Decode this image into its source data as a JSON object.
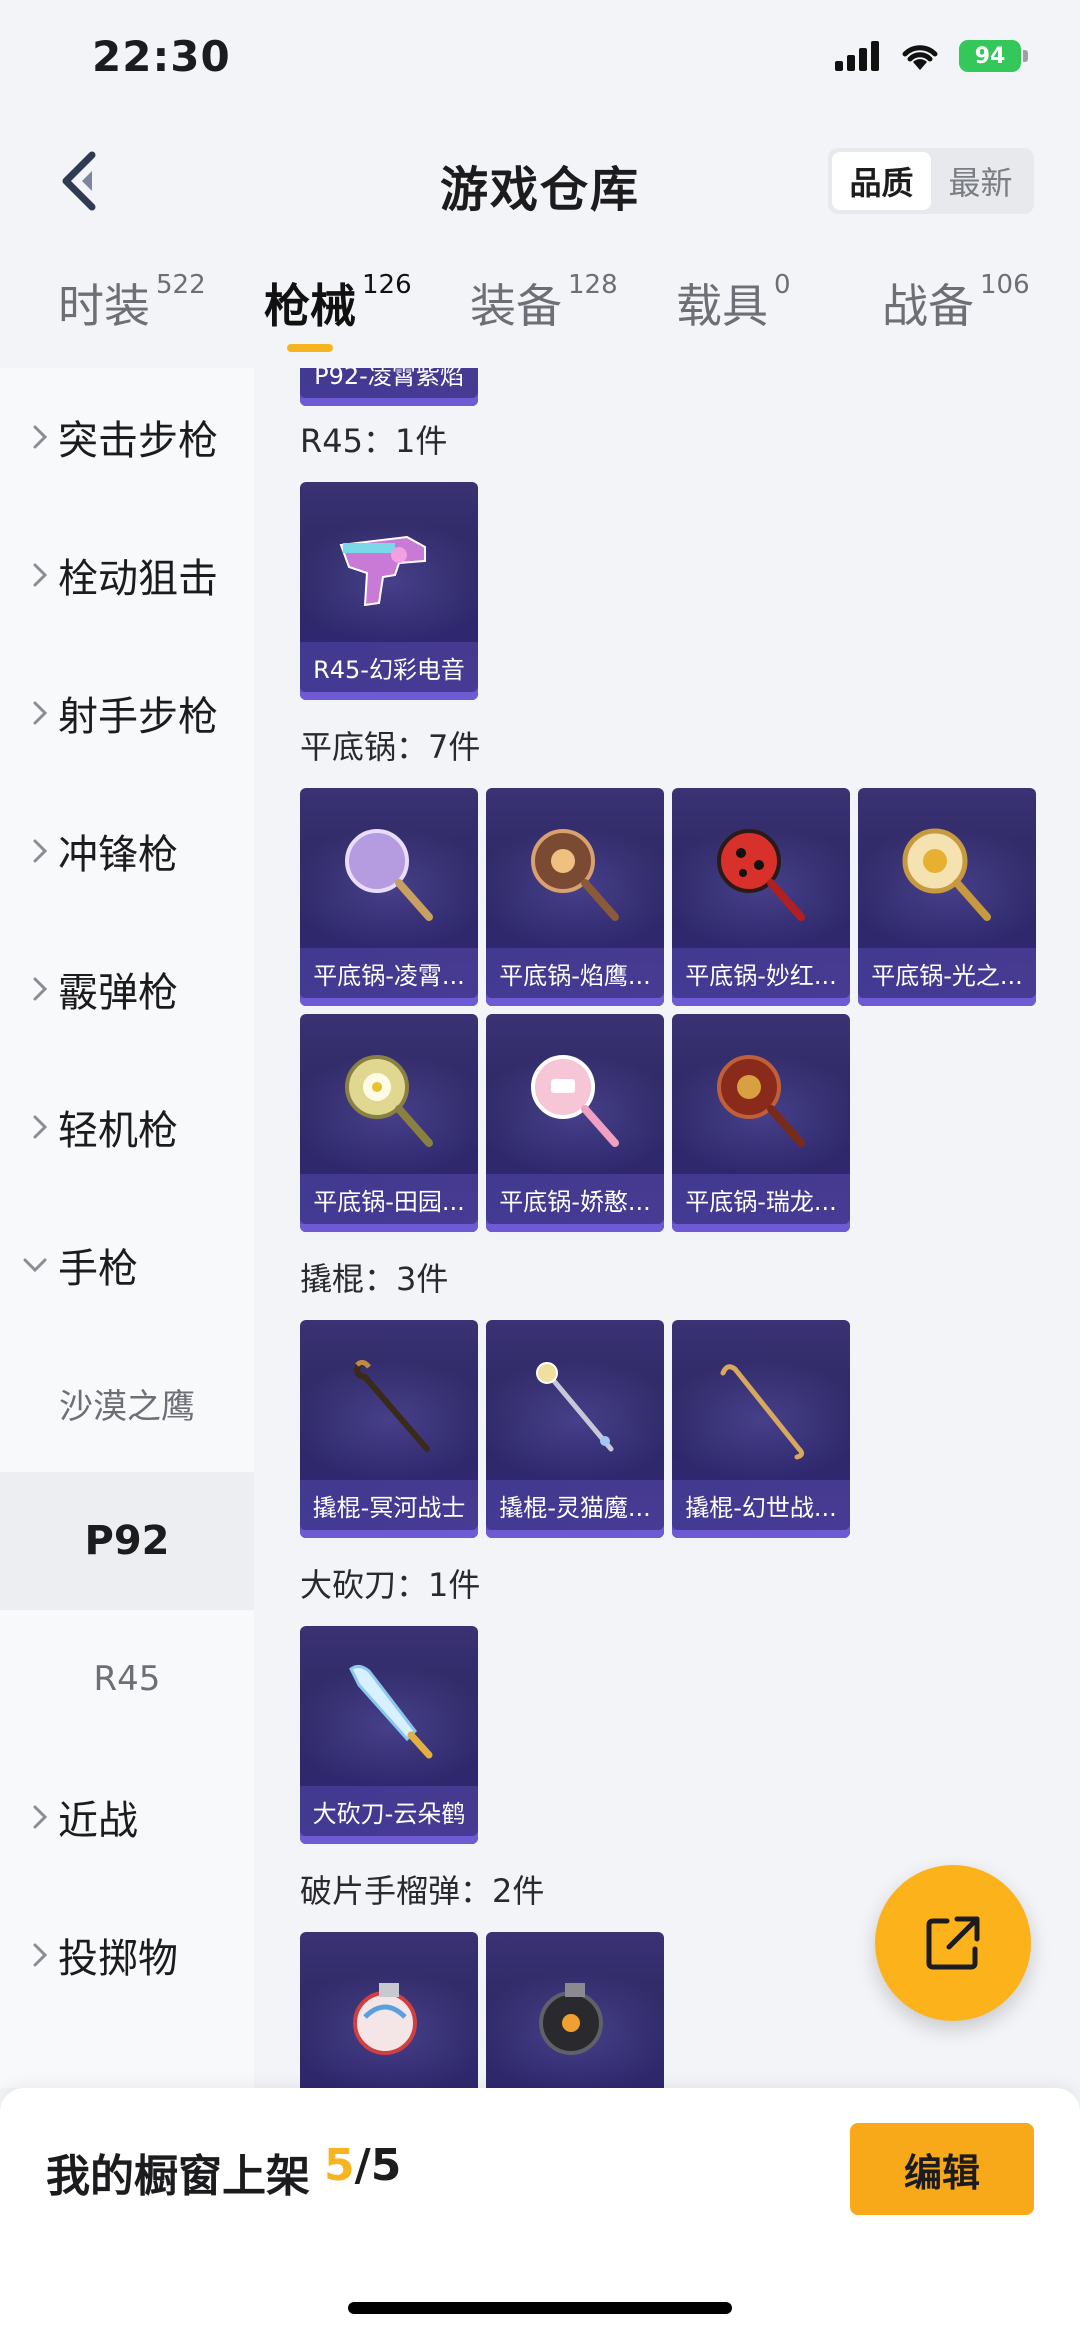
{
  "status": {
    "time": "22:30",
    "battery": "94"
  },
  "header": {
    "title": "游戏仓库",
    "sort_options": [
      "品质",
      "最新"
    ],
    "sort_active": "品质"
  },
  "tabs": [
    {
      "label": "时装",
      "count": "522"
    },
    {
      "label": "枪械",
      "count": "126"
    },
    {
      "label": "装备",
      "count": "128"
    },
    {
      "label": "载具",
      "count": "0"
    },
    {
      "label": "战备",
      "count": "106"
    }
  ],
  "sidebar": {
    "items": [
      "突击步枪",
      "栓动狙击",
      "射手步枪",
      "冲锋枪",
      "霰弹枪",
      "轻机枪",
      "手枪"
    ],
    "sub_items": [
      "沙漠之鹰",
      "P92",
      "R45"
    ],
    "items_after": [
      "近战",
      "投掷物"
    ]
  },
  "content": {
    "top_card_partial": "P92-凌霄紫焰",
    "sections": [
      {
        "title": "R45：1件",
        "cards": [
          "R45-幻彩电音"
        ]
      },
      {
        "title": "平底锅：7件",
        "cards": [
          "平底锅-凌霄...",
          "平底锅-焰鹰...",
          "平底锅-妙红...",
          "平底锅-光之...",
          "平底锅-田园...",
          "平底锅-娇憨...",
          "平底锅-瑞龙..."
        ]
      },
      {
        "title": "撬棍：3件",
        "cards": [
          "撬棍-冥河战士",
          "撬棍-灵猫魔...",
          "撬棍-幻世战..."
        ]
      },
      {
        "title": "大砍刀：1件",
        "cards": [
          "大砍刀-云朵鹤"
        ]
      },
      {
        "title": "破片手榴弹：2件",
        "cards": [
          "",
          ""
        ]
      }
    ]
  },
  "bottom": {
    "label": "我的橱窗上架",
    "count_current": "5",
    "count_total": "/5",
    "edit": "编辑"
  },
  "colors": {
    "accent": "#f6b421",
    "card_bg": "#2c2763",
    "fab": "#fbb21b"
  }
}
